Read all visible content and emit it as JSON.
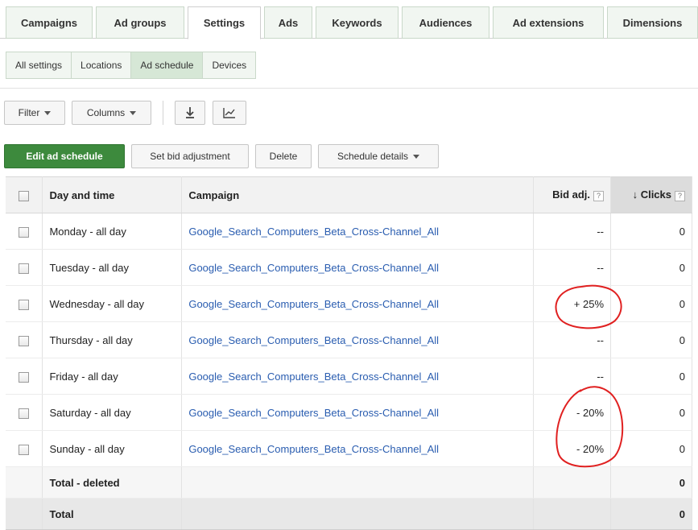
{
  "tabs": [
    {
      "label": "Campaigns",
      "active": false
    },
    {
      "label": "Ad groups",
      "active": false
    },
    {
      "label": "Settings",
      "active": true
    },
    {
      "label": "Ads",
      "active": false
    },
    {
      "label": "Keywords",
      "active": false
    },
    {
      "label": "Audiences",
      "active": false
    },
    {
      "label": "Ad extensions",
      "active": false
    },
    {
      "label": "Dimensions",
      "active": false
    }
  ],
  "subtabs": [
    {
      "label": "All settings",
      "active": false
    },
    {
      "label": "Locations",
      "active": false
    },
    {
      "label": "Ad schedule",
      "active": true
    },
    {
      "label": "Devices",
      "active": false
    }
  ],
  "toolbar": {
    "filter_label": "Filter",
    "columns_label": "Columns",
    "download_icon": "download-icon",
    "chart_icon": "chart-icon",
    "edit_schedule_label": "Edit ad schedule",
    "set_bid_label": "Set bid adjustment",
    "delete_label": "Delete",
    "schedule_details_label": "Schedule details"
  },
  "table": {
    "headers": {
      "day": "Day and time",
      "campaign": "Campaign",
      "bid": "Bid adj.",
      "clicks": "Clicks",
      "help": "?",
      "sort_arrow": "↓"
    },
    "rows": [
      {
        "day": "Monday - all day",
        "campaign": "Google_Search_Computers_Beta_Cross-Channel_All",
        "bid": "--",
        "clicks": "0"
      },
      {
        "day": "Tuesday - all day",
        "campaign": "Google_Search_Computers_Beta_Cross-Channel_All",
        "bid": "--",
        "clicks": "0"
      },
      {
        "day": "Wednesday - all day",
        "campaign": "Google_Search_Computers_Beta_Cross-Channel_All",
        "bid": "+ 25%",
        "clicks": "0"
      },
      {
        "day": "Thursday - all day",
        "campaign": "Google_Search_Computers_Beta_Cross-Channel_All",
        "bid": "--",
        "clicks": "0"
      },
      {
        "day": "Friday - all day",
        "campaign": "Google_Search_Computers_Beta_Cross-Channel_All",
        "bid": "--",
        "clicks": "0"
      },
      {
        "day": "Saturday - all day",
        "campaign": "Google_Search_Computers_Beta_Cross-Channel_All",
        "bid": "- 20%",
        "clicks": "0"
      },
      {
        "day": "Sunday - all day",
        "campaign": "Google_Search_Computers_Beta_Cross-Channel_All",
        "bid": "- 20%",
        "clicks": "0"
      }
    ],
    "total_deleted": {
      "label": "Total - deleted",
      "clicks": "0"
    },
    "total": {
      "label": "Total",
      "clicks": "0"
    }
  },
  "colors": {
    "accent_green": "#3d8a3d",
    "link_blue": "#2a5db0",
    "annotation_red": "#e02020"
  }
}
